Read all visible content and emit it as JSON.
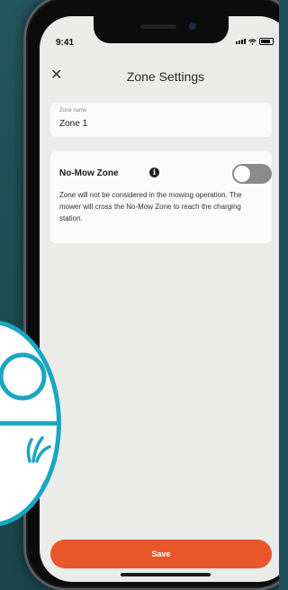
{
  "status_bar": {
    "time": "9:41"
  },
  "header": {
    "close_icon": "close-icon",
    "title": "Zone Settings"
  },
  "zone_name": {
    "label": "Zone name",
    "value": "Zone 1"
  },
  "no_mow": {
    "title": "No-Mow Zone",
    "info_icon": "info-icon",
    "toggle_on": false,
    "description": "Zone will not be considered in the mowing operation. The mower will cross the No-Mow Zone to reach the charging station."
  },
  "footer": {
    "save_label": "Save"
  },
  "colors": {
    "accent": "#e8562a",
    "badge_ring": "#19a6c2",
    "background": "#1f4f58"
  }
}
